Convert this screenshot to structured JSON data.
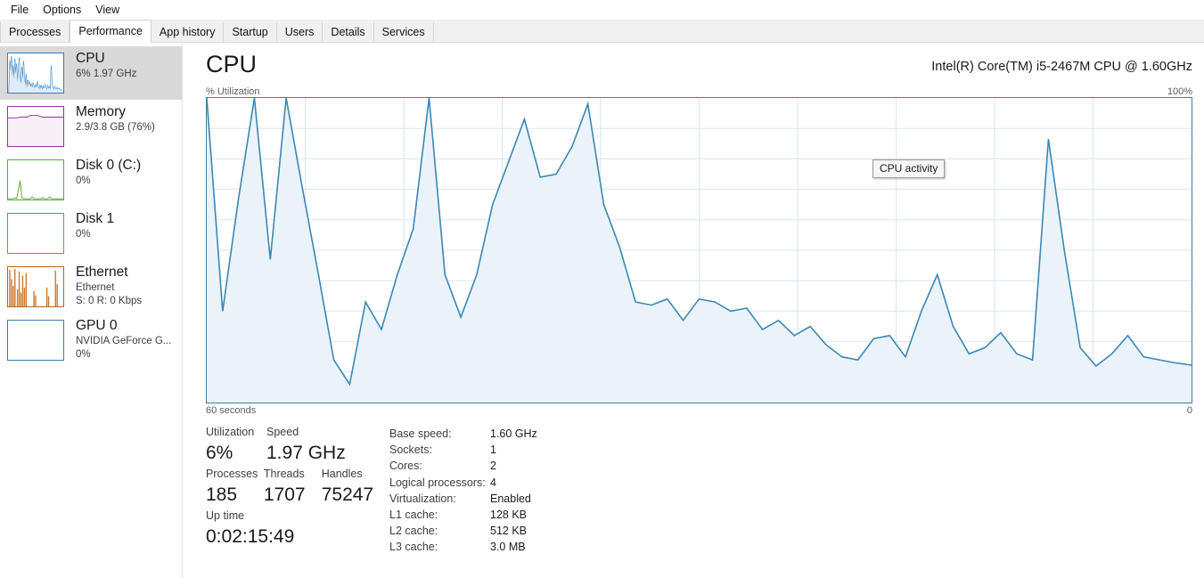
{
  "menu": {
    "items": [
      {
        "label": "File"
      },
      {
        "label": "Options"
      },
      {
        "label": "View"
      }
    ]
  },
  "tabs": [
    {
      "label": "Processes",
      "active": false
    },
    {
      "label": "Performance",
      "active": true
    },
    {
      "label": "App history",
      "active": false
    },
    {
      "label": "Startup",
      "active": false
    },
    {
      "label": "Users",
      "active": false
    },
    {
      "label": "Details",
      "active": false
    },
    {
      "label": "Services",
      "active": false
    }
  ],
  "sidebar": {
    "items": [
      {
        "name": "cpu",
        "title": "CPU",
        "sub1": "6%  1.97 GHz",
        "sub2": "",
        "selected": true,
        "color": "#2a7fc9",
        "fill": "#eaf3fb"
      },
      {
        "name": "memory",
        "title": "Memory",
        "sub1": "2.9/3.8 GB (76%)",
        "sub2": "",
        "selected": false,
        "color": "#8a3a8f",
        "fill": "#f7f1f7"
      },
      {
        "name": "disk-0",
        "title": "Disk 0 (C:)",
        "sub1": "0%",
        "sub2": "",
        "selected": false,
        "color": "#5aa832",
        "fill": "#ffffff"
      },
      {
        "name": "disk-1",
        "title": "Disk 1",
        "sub1": "0%",
        "sub2": "",
        "selected": false,
        "color": "#5aa832",
        "fill": "#ffffff"
      },
      {
        "name": "ethernet",
        "title": "Ethernet",
        "sub1": "Ethernet",
        "sub2": "S: 0 R: 0 Kbps",
        "selected": false,
        "color": "#b5651d",
        "fill": "#ffffff"
      },
      {
        "name": "gpu-0",
        "title": "GPU 0",
        "sub1": "NVIDIA GeForce G...",
        "sub2": "0%",
        "selected": false,
        "color": "#3a7ca8",
        "fill": "#ffffff"
      }
    ]
  },
  "main": {
    "title": "CPU",
    "model": "Intel(R) Core(TM) i5-2467M CPU @ 1.60GHz",
    "axis_top_left": "% Utilization",
    "axis_top_right": "100%",
    "axis_bottom_left": "60 seconds",
    "axis_bottom_right": "0",
    "tooltip": "CPU activity"
  },
  "stats": {
    "utilization_label": "Utilization",
    "utilization_value": "6%",
    "speed_label": "Speed",
    "speed_value": "1.97 GHz",
    "processes_label": "Processes",
    "processes_value": "185",
    "threads_label": "Threads",
    "threads_value": "1707",
    "handles_label": "Handles",
    "handles_value": "75247",
    "uptime_label": "Up time",
    "uptime_value": "0:02:15:49"
  },
  "details": [
    {
      "key": "Base speed:",
      "value": "1.60 GHz"
    },
    {
      "key": "Sockets:",
      "value": "1"
    },
    {
      "key": "Cores:",
      "value": "2"
    },
    {
      "key": "Logical processors:",
      "value": "4"
    },
    {
      "key": "Virtualization:",
      "value": "Enabled"
    },
    {
      "key": "L1 cache:",
      "value": "128 KB"
    },
    {
      "key": "L2 cache:",
      "value": "512 KB"
    },
    {
      "key": "L3 cache:",
      "value": "3.0 MB"
    }
  ],
  "chart_data": {
    "type": "area",
    "title": "CPU % Utilization over 60 seconds",
    "xlabel": "60 seconds",
    "ylabel": "% Utilization",
    "xlim": [
      0,
      60
    ],
    "ylim": [
      0,
      100
    ],
    "grid": true,
    "line_color": "#3a87b4",
    "fill_color": "#eaf3fa",
    "x_tick_labels": [
      "60 seconds",
      "0"
    ],
    "y_tick_labels": [
      "100%",
      "0"
    ],
    "y_gridlines": [
      10,
      20,
      30,
      40,
      50,
      60,
      70,
      80,
      90
    ],
    "x_gridlines": [
      6,
      12,
      18,
      24,
      30,
      36,
      42,
      48,
      54
    ],
    "series": [
      {
        "name": "CPU utilization",
        "values": [
          100,
          30,
          67,
          100,
          47,
          100,
          71,
          43,
          14,
          6,
          33,
          24,
          42,
          57,
          100,
          42,
          28,
          42,
          65,
          79,
          93,
          74,
          75,
          84,
          98,
          65,
          51,
          33,
          32,
          34,
          27,
          32,
          31,
          28,
          29,
          24,
          27,
          22,
          25,
          20,
          16,
          15,
          19,
          20,
          16,
          22,
          27,
          19,
          13,
          18,
          19,
          16,
          15,
          58,
          33,
          16,
          12,
          14,
          19,
          15,
          13,
          12
        ]
      }
    ],
    "annotations": [
      {
        "text": "CPU activity",
        "type": "tooltip"
      }
    ]
  }
}
